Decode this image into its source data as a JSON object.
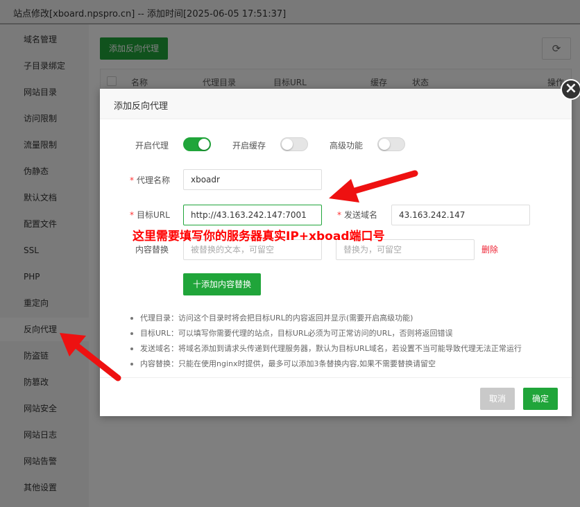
{
  "window": {
    "title": "站点修改[xboard.npspro.cn] -- 添加时间[2025-06-05 17:51:37]"
  },
  "sidebar": {
    "items": [
      {
        "label": "域名管理"
      },
      {
        "label": "子目录绑定"
      },
      {
        "label": "网站目录"
      },
      {
        "label": "访问限制"
      },
      {
        "label": "流量限制"
      },
      {
        "label": "伪静态"
      },
      {
        "label": "默认文档"
      },
      {
        "label": "配置文件"
      },
      {
        "label": "SSL"
      },
      {
        "label": "PHP"
      },
      {
        "label": "重定向"
      },
      {
        "label": "反向代理"
      },
      {
        "label": "防盗链"
      },
      {
        "label": "防篡改"
      },
      {
        "label": "网站安全"
      },
      {
        "label": "网站日志"
      },
      {
        "label": "网站告警"
      },
      {
        "label": "其他设置"
      }
    ],
    "active_index": 11
  },
  "main": {
    "add_button": "添加反向代理",
    "table_headers": [
      "名称",
      "代理目录",
      "目标URL",
      "缓存",
      "状态",
      "操作"
    ]
  },
  "modal": {
    "title": "添加反向代理",
    "close_glyph": "×",
    "toggles": {
      "enable_proxy": {
        "label": "开启代理",
        "on": true
      },
      "enable_cache": {
        "label": "开启缓存",
        "on": false
      },
      "advanced": {
        "label": "高级功能",
        "on": false
      }
    },
    "proxy_name": {
      "label": "代理名称",
      "value": "xboadr"
    },
    "target_url": {
      "label": "目标URL",
      "value": "http://43.163.242.147:7001"
    },
    "send_domain": {
      "label": "发送域名",
      "value": "43.163.242.147"
    },
    "content_replace": {
      "label": "内容替换",
      "from_placeholder": "被替换的文本，可留空",
      "to_placeholder": "替换为，可留空",
      "delete_label": "删除",
      "add_button": "十添加内容替换"
    },
    "tips": [
      "代理目录：访问这个目录时将会把目标URL的内容返回并显示(需要开启高级功能)",
      "目标URL：可以填写你需要代理的站点，目标URL必须为可正常访问的URL，否则将返回错误",
      "发送域名：将域名添加到请求头传递到代理服务器，默认为目标URL域名，若设置不当可能导致代理无法正常运行",
      "内容替换：只能在使用nginx时提供，最多可以添加3条替换内容,如果不需要替换请留空"
    ],
    "cancel_label": "取消",
    "ok_label": "确定"
  },
  "annotation": {
    "text": "这里需要填写你的服务器真实IP+xboad端口号",
    "color": "#ff0000"
  },
  "colors": {
    "accent": "#20a53a",
    "danger": "#ee2233"
  }
}
